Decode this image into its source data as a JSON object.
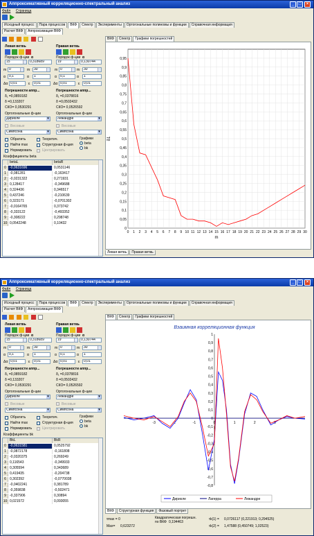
{
  "title": "Аппроксимативный корреляционно-спектральный анализ",
  "menu": [
    "Файл",
    "Страница"
  ],
  "main_tabs": [
    "Исходный процесс",
    "Пара процессов",
    "ВКФ",
    "Спектр",
    "Эксперименты",
    "Ортогональные полиномы и функции",
    "Справочная информация"
  ],
  "sub_tabs": [
    "Расчет ВКФ",
    "Аппроксимация ВКФ"
  ],
  "left": {
    "left_branch": "Левая ветвь",
    "right_branch": "Правая ветвь",
    "order_label": "Порядок ф-ции",
    "alpha_label": "α",
    "left_order": "15",
    "left_alpha": "0,318689",
    "right_order": "19",
    "right_alpha": "0,130744",
    "m_label": "m",
    "left_m": "0",
    "left_m_sub": "x",
    "left_m2": "30",
    "right_m": "0",
    "right_m2": "30",
    "a_label": "α",
    "left_a0": "0,1",
    "left_a1": "1",
    "right_a0": "0,1",
    "right_a1": "1",
    "dalpha_label": "Δα",
    "eps_label": "ε",
    "left_dalpha": "0,01",
    "left_eps": "0,01",
    "right_dalpha": "0,01",
    "right_eps": "0,01",
    "errors_title": "Погрешности аппр...",
    "left_delta1": "δ₁ =0,0859182",
    "left_delta": "δ =0,133207",
    "left_sko": "СКО= 0,0530291",
    "right_delta1": "δ₁ =0,0378816",
    "right_delta": "δ =0,0502432",
    "right_sko": "СКО= 0,0526592",
    "orth_title": "Ортогональные ф-ции",
    "left_func": "Дирихле",
    "right_func": "Лежандре",
    "weight_label": "Весовые",
    "simpson": "Симпсона",
    "reverse": "Обратить",
    "theoretical": "Теоретич.",
    "find_max": "Найти max",
    "structural": "Структурная ф-ция",
    "normalize": "Нормировать",
    "centering": "Центрировать",
    "graphs_label": "Графики",
    "beta_opt": "beta",
    "bk_opt": "bk"
  },
  "w1": {
    "coef_label": "Коэффициенты beta",
    "col1": "betaL",
    "col2": "betaR",
    "rows": [
      [
        "0",
        "-0,0631696",
        "0,0531146"
      ],
      [
        "1",
        "-0,081281",
        "-0,163417"
      ],
      [
        "2",
        "-0,0231322",
        "0,271931"
      ],
      [
        "3",
        "0,128417",
        "-0,349688"
      ],
      [
        "4",
        "0,324436",
        "0,346517"
      ],
      [
        "5",
        "0,437246",
        "-0,210639"
      ],
      [
        "6",
        "0,323171",
        "-0,0701302"
      ],
      [
        "7",
        "-0,0164765",
        "0,373742"
      ],
      [
        "8",
        "-0,333122",
        "-0,493352"
      ],
      [
        "9",
        "-0,308222",
        "0,298748"
      ],
      [
        "10",
        "0,0542248",
        "0,10432"
      ]
    ],
    "graph_tabs": [
      "ВКФ",
      "Спектр",
      "Графики погрешностей"
    ],
    "bottom_tabs": [
      "Левая ветвь",
      "Правая ветвь"
    ],
    "chart_ylabel": "δ1",
    "chart_xlabel": "m"
  },
  "w2": {
    "coef_label": "Коэффициенты bk",
    "col1": "BkL",
    "col2": "BkR",
    "rows": [
      [
        "0",
        "-0,0631581",
        "0,0525792"
      ],
      [
        "1",
        "-0,0872178",
        "-0,161808"
      ],
      [
        "2",
        "-0,0320375",
        "0,269249"
      ],
      [
        "3",
        "0,116543",
        "-0,349933"
      ],
      [
        "4",
        "0,305594",
        "0,343689"
      ],
      [
        "5",
        "0,419435",
        "-0,204738"
      ],
      [
        "6",
        "0,302392",
        "-0,0770038"
      ],
      [
        "7",
        "-0,0402241",
        "0,381789"
      ],
      [
        "8",
        "-0,359838",
        "-0,502471"
      ],
      [
        "9",
        "-0,337906",
        "0,30894"
      ],
      [
        "10",
        "0,021572",
        "0,093055"
      ]
    ],
    "graph_tabs": [
      "ВКФ",
      "Спектр",
      "Графики погрешностей"
    ],
    "bottom_tabs": [
      "ВКФ",
      "Структурная функция",
      "Фазовый портрет"
    ],
    "chart_xlabel": "τ",
    "info": {
      "tmax_label": "τmax = 0",
      "max_label": "Max=",
      "max_value": "0,623272",
      "quad_label": "Квадратическая погрешн.",
      "quad_sub": "по ВКФ",
      "quad_value": "0,194463",
      "tk1_label": "τk(1) =",
      "tk1_value": "0,0726117 (0,221913; 0,294525)",
      "tk2_label": "τk(2) =",
      "tk2_value": "1,47588 (0,450749; 1,02523)"
    }
  },
  "chart_data": [
    {
      "type": "line",
      "x": [
        0,
        1,
        2,
        3,
        4,
        5,
        6,
        7,
        8,
        9,
        10,
        11,
        12,
        13,
        14,
        15,
        16,
        17,
        18,
        19,
        20,
        21,
        22,
        23,
        24,
        25,
        26,
        27,
        28,
        29,
        30
      ],
      "series": [
        {
          "values": [
            0.95,
            0.58,
            0.42,
            0.41,
            0.34,
            0.27,
            0.18,
            0.17,
            0.16,
            0.07,
            0.05,
            0.05,
            0.04,
            0.04,
            0.03,
            0.01,
            0.03,
            0.02,
            0.03,
            0.04,
            0.05,
            0.07,
            0.08,
            0.1,
            0.12,
            0.14,
            0.16,
            0.18,
            0.2,
            0.22,
            0.24
          ]
        }
      ],
      "xlabel": "m",
      "ylabel": "δ1",
      "xlim": [
        0,
        30
      ],
      "ylim": [
        0,
        1
      ],
      "yticks": [
        "0",
        "0,05",
        "0,1",
        "0,15",
        "0,2",
        "0,25",
        "0,3",
        "0,35",
        "0,4",
        "0,45",
        "0,5",
        "0,55",
        "0,6",
        "0,65",
        "0,7",
        "0,75",
        "0,8",
        "0,85",
        "0,9",
        "0,95"
      ],
      "grid": true,
      "color": "#ff0000"
    },
    {
      "type": "line",
      "title": "Взаимная корреляционная функция",
      "x": [
        -4.5,
        -4,
        -3.5,
        -3,
        -2.6,
        -2.2,
        -1.8,
        -1.5,
        -1.2,
        -0.9,
        -0.6,
        -0.3,
        0,
        0.2,
        0.4,
        0.6,
        0.8,
        1.0,
        1.2,
        1.5,
        1.8,
        2.1,
        2.4,
        2.8,
        3.2,
        3.6,
        4,
        4.5
      ],
      "series": [
        {
          "name": "Дирихле",
          "color": "#0000ff",
          "values": [
            0.01,
            -0.02,
            0.0,
            0.03,
            -0.06,
            -0.12,
            0.0,
            0.18,
            0.34,
            0.22,
            -0.18,
            -0.62,
            -0.25,
            0.55,
            0.45,
            0.1,
            -0.55,
            -0.78,
            -0.5,
            0.05,
            0.3,
            0.26,
            0.1,
            -0.08,
            -0.02,
            0.02,
            0.0,
            -0.01
          ]
        },
        {
          "name": "Лагерра",
          "color": "#000080",
          "values": [
            0.0,
            0.0,
            0.0,
            0.0,
            0.0,
            0.0,
            0.0,
            0.0,
            0.0,
            0.0,
            0.0,
            0.0,
            0.0,
            0.0,
            0.0,
            0.0,
            0.0,
            0.0,
            0.0,
            0.0,
            0.0,
            0.0,
            0.0,
            0.0,
            0.0,
            0.0,
            0.0,
            0.0
          ]
        },
        {
          "name": "Лежандре",
          "color": "#ff0000",
          "values": [
            0.03,
            0.0,
            -0.02,
            0.02,
            -0.04,
            -0.1,
            0.02,
            0.2,
            0.3,
            0.2,
            -0.1,
            -0.45,
            -0.3,
            0.95,
            0.6,
            0.05,
            -0.58,
            -0.75,
            -0.48,
            0.08,
            0.28,
            0.22,
            0.08,
            -0.06,
            -0.02,
            0.03,
            0.0,
            0.02
          ]
        }
      ],
      "xlabel": "τ",
      "xlim": [
        -4.5,
        4.5
      ],
      "ylim": [
        -0.8,
        1.0
      ],
      "xticks": [
        -3,
        -2,
        -1,
        0,
        1,
        2,
        3
      ],
      "yticks": [
        -0.8,
        -0.7,
        -0.6,
        -0.5,
        -0.4,
        -0.3,
        -0.2,
        -0.1,
        0,
        0.1,
        0.2,
        0.3,
        0.4,
        0.5,
        0.6,
        0.7,
        0.8,
        0.9,
        1
      ],
      "legend": "bottom",
      "grid": false
    }
  ]
}
